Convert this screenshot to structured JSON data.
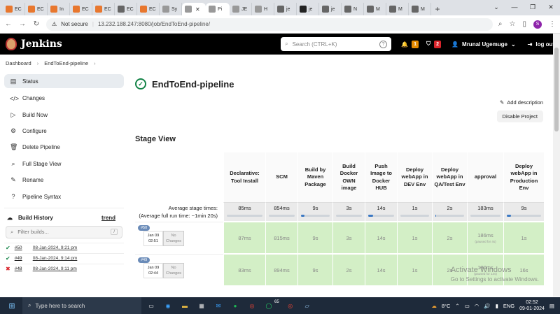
{
  "browser": {
    "tabs": [
      {
        "label": "EC",
        "color": "#e8772e"
      },
      {
        "label": "EC",
        "color": "#e8772e"
      },
      {
        "label": "In",
        "color": "#e8772e"
      },
      {
        "label": "EC",
        "color": "#e8772e"
      },
      {
        "label": "EC",
        "color": "#e8772e"
      },
      {
        "label": "EC",
        "color": "#666666"
      },
      {
        "label": "EC",
        "color": "#e8772e"
      },
      {
        "label": "Sy",
        "color": "#999999"
      },
      {
        "label": "Pi",
        "color": "#999999"
      },
      {
        "label": "JE",
        "color": "#999999"
      },
      {
        "label": "H",
        "color": "#999999"
      },
      {
        "label": "je",
        "color": "#666666"
      },
      {
        "label": "je",
        "color": "#222222"
      },
      {
        "label": "je",
        "color": "#666666"
      },
      {
        "label": "N",
        "color": "#666666"
      },
      {
        "label": "M",
        "color": "#666666"
      },
      {
        "label": "M",
        "color": "#666666"
      },
      {
        "label": "M",
        "color": "#666666"
      }
    ],
    "not_secure": "Not secure",
    "url": "13.232.188.247:8080/job/EndToEnd-pipeline/",
    "profile_initial": "S"
  },
  "header": {
    "logo": "Jenkins",
    "search_placeholder": "Search (CTRL+K)",
    "help": "?",
    "notif_count": "1",
    "security_count": "2",
    "user": "Mrunal Ugemuge",
    "logout": "log out"
  },
  "breadcrumb": [
    "Dashboard",
    "EndToEnd-pipeline"
  ],
  "sidebar": {
    "items": [
      {
        "label": "Status",
        "icon": "▤"
      },
      {
        "label": "Changes",
        "icon": "</>"
      },
      {
        "label": "Build Now",
        "icon": "▷"
      },
      {
        "label": "Configure",
        "icon": "⚙"
      },
      {
        "label": "Delete Pipeline",
        "icon": "🗑"
      },
      {
        "label": "Full Stage View",
        "icon": "⌕"
      },
      {
        "label": "Rename",
        "icon": "✎"
      },
      {
        "label": "Pipeline Syntax",
        "icon": "?"
      }
    ],
    "build_history": "Build History",
    "trend": "trend",
    "filter_placeholder": "Filter builds...",
    "filter_key": "/",
    "builds": [
      {
        "num": "#50",
        "date": "08-Jan-2024, 9:21 pm",
        "status": "ok"
      },
      {
        "num": "#49",
        "date": "08-Jan-2024, 9:14 pm",
        "status": "ok"
      },
      {
        "num": "#48",
        "date": "08-Jan-2024, 9:11 pm",
        "status": "fail"
      }
    ]
  },
  "main": {
    "title": "EndToEnd-pipeline",
    "add_description": "Add description",
    "disable_project": "Disable Project",
    "stage_view_title": "Stage View",
    "avg_label_1": "Average stage times:",
    "avg_label_2": "(Average full run time: ~1min 20s)",
    "stages": [
      {
        "name": "Declarative: Tool Install",
        "avg": "85ms",
        "fill": 0
      },
      {
        "name": "SCM",
        "avg": "854ms",
        "fill": 0
      },
      {
        "name": "Build by Maven Package",
        "avg": "9s",
        "fill": 0.12
      },
      {
        "name": "Build Docker OWN image",
        "avg": "3s",
        "fill": 0
      },
      {
        "name": "Push Image to Docker HUB",
        "avg": "14s",
        "fill": 0.18
      },
      {
        "name": "Deploy webApp in DEV Env",
        "avg": "1s",
        "fill": 0
      },
      {
        "name": "Deploy webApp in QA/Test Env",
        "avg": "2s",
        "fill": 0.02
      },
      {
        "name": "approval",
        "avg": "183ms",
        "fill": 0
      },
      {
        "name": "Deploy webApp in Production Env",
        "avg": "9s",
        "fill": 0.12
      }
    ],
    "runs": [
      {
        "label": "#50",
        "date": "Jan 09",
        "time": "02:51",
        "changes": "No Changes",
        "cells": [
          "87ms",
          "815ms",
          "9s",
          "3s",
          "14s",
          "1s",
          "2s",
          "186ms",
          "1s"
        ],
        "approval_sub": "(paused for 4s)"
      },
      {
        "label": "#49",
        "date": "Jan 09",
        "time": "02:44",
        "changes": "No Changes",
        "cells": [
          "83ms",
          "894ms",
          "9s",
          "2s",
          "14s",
          "1s",
          "2s",
          "180ms",
          "16s"
        ],
        "approval_sub": "(paused for 14s)"
      }
    ]
  },
  "watermark": {
    "line1": "Activate Windows",
    "line2": "Go to Settings to activate Windows."
  },
  "taskbar": {
    "search": "Type here to search",
    "weather": "8°C",
    "lang": "ENG",
    "time": "02:52",
    "date": "09-01-2024",
    "whatsapp_count": "65"
  }
}
